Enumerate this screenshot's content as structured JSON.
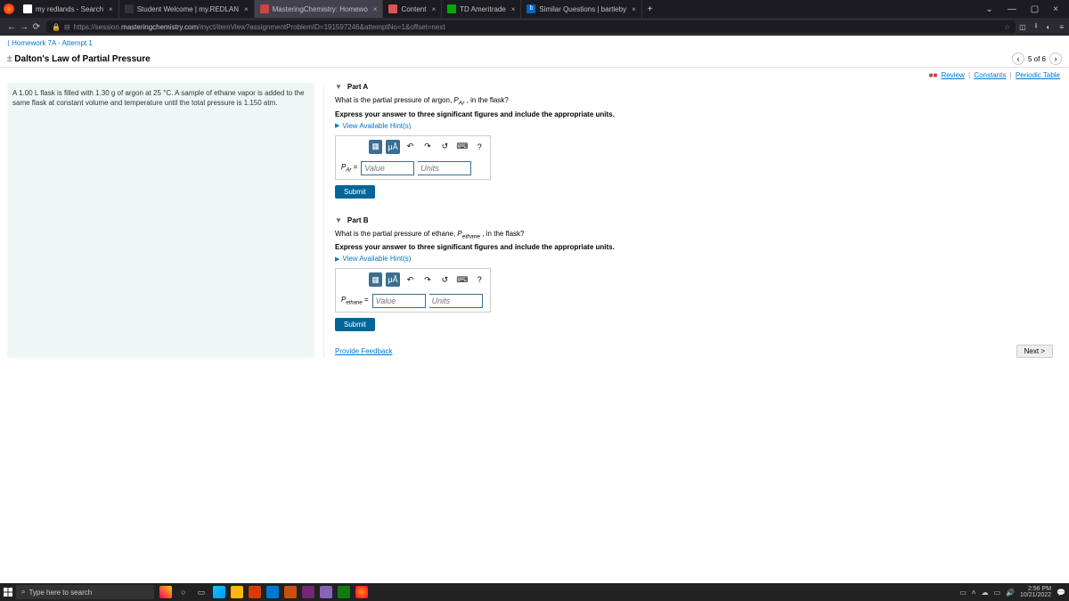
{
  "browser": {
    "tabs": [
      {
        "label": "my redlands - Search"
      },
      {
        "label": "Student Welcome | my.REDLAN"
      },
      {
        "label": "MasteringChemistry: Homewo"
      },
      {
        "label": "Content"
      },
      {
        "label": "TD Ameritrade"
      },
      {
        "label": "Similar Questions | bartleby"
      }
    ],
    "url_prefix": "https://session.",
    "url_domain": "masteringchemistry.com",
    "url_path": "/myct/itemView?assignmentProblemID=191597246&attemptNo=1&offset=next"
  },
  "page": {
    "breadcrumb": "Homework 7A - Attempt 1",
    "title": "Dalton's Law of Partial Pressure",
    "pager": "5 of 6",
    "links": {
      "review": "Review",
      "constants": "Constants",
      "periodic": "Periodic Table"
    },
    "problem": "A 1.00 L flask is filled with 1.30 g of argon at 25 °C. A sample of ethane vapor is added to the same flask at constant volume and temperature until the total pressure is 1.150 atm.",
    "partA": {
      "header": "Part A",
      "q_pre": "What is the partial pressure of argon, ",
      "q_var": "P",
      "q_sub": "Ar",
      "q_post": " , in the flask?",
      "instr": "Express your answer to three significant figures and include the appropriate units.",
      "hints": "View Available Hint(s)",
      "lbl_var": "P",
      "lbl_sub": "Ar",
      "value_ph": "Value",
      "units_ph": "Units",
      "submit": "Submit"
    },
    "partB": {
      "header": "Part B",
      "q_pre": "What is the partial pressure of ethane, ",
      "q_var": "P",
      "q_sub": "ethane",
      "q_post": " , in the flask?",
      "instr": "Express your answer to three significant figures and include the appropriate units.",
      "hints": "View Available Hint(s)",
      "lbl_var": "P",
      "lbl_sub": "ethane",
      "value_ph": "Value",
      "units_ph": "Units",
      "submit": "Submit"
    },
    "feedback": "Provide Feedback",
    "next": "Next >"
  },
  "taskbar": {
    "search_ph": "Type here to search",
    "time": "2:56 PM",
    "date": "10/21/2022"
  }
}
